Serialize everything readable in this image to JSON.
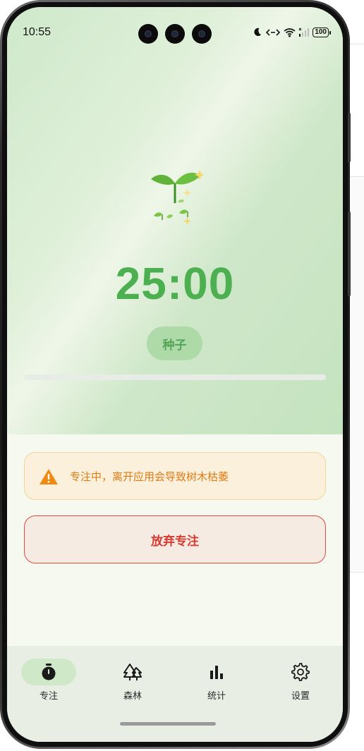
{
  "status_bar": {
    "time": "10:55",
    "battery": "100"
  },
  "timer": {
    "display": "25:00",
    "progress": 0
  },
  "stage": {
    "label": "种子"
  },
  "warning": {
    "text": "专注中，离开应用会导致树木枯萎"
  },
  "actions": {
    "abandon_label": "放弃专注"
  },
  "nav": {
    "items": [
      {
        "label": "专注",
        "icon": "timer-icon",
        "active": true
      },
      {
        "label": "森林",
        "icon": "forest-icon",
        "active": false
      },
      {
        "label": "统计",
        "icon": "bar-chart-icon",
        "active": false
      },
      {
        "label": "设置",
        "icon": "gear-icon",
        "active": false
      }
    ]
  },
  "colors": {
    "accent": "#4caf50",
    "warning": "#e07a12",
    "danger": "#d63a31"
  }
}
